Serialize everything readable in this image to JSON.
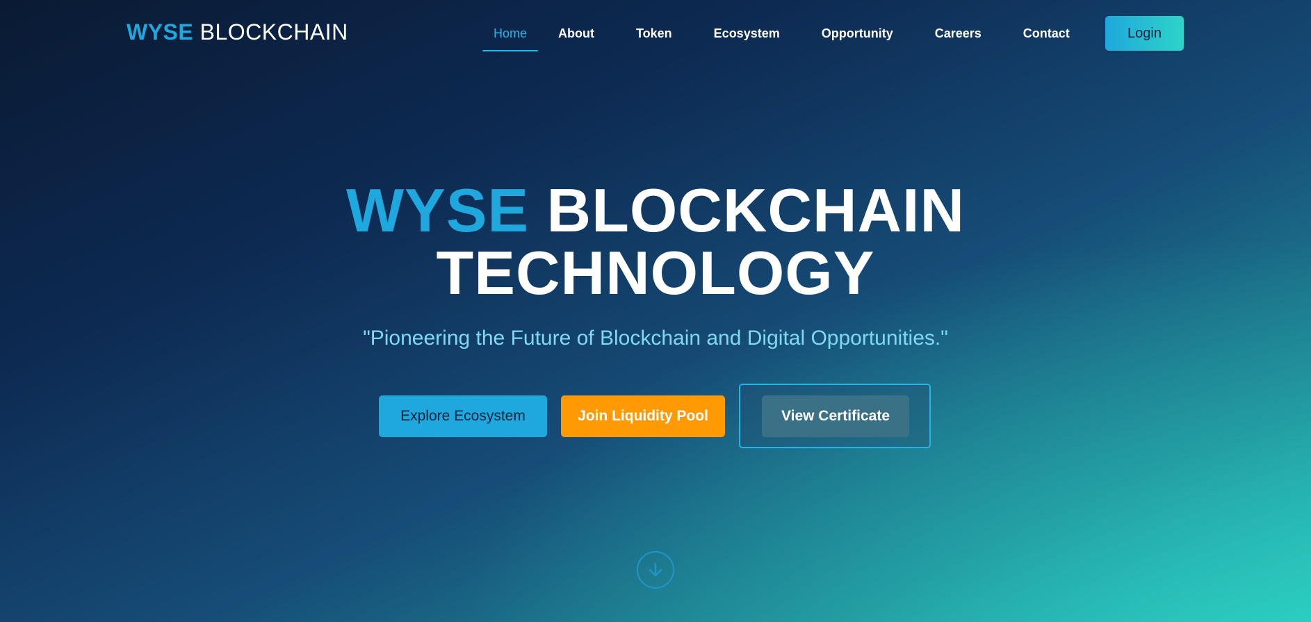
{
  "brand": {
    "accent": "WYSE",
    "rest": "BLOCKCHAIN"
  },
  "nav": {
    "items": [
      {
        "label": "Home",
        "active": true
      },
      {
        "label": "About",
        "active": false
      },
      {
        "label": "Token",
        "active": false
      },
      {
        "label": "Ecosystem",
        "active": false
      },
      {
        "label": "Opportunity",
        "active": false
      },
      {
        "label": "Careers",
        "active": false
      },
      {
        "label": "Contact",
        "active": false
      }
    ],
    "login_label": "Login"
  },
  "hero": {
    "title_accent": "WYSE",
    "title_line1_rest": "BLOCKCHAIN",
    "title_line2": "TECHNOLOGY",
    "tagline": "\"Pioneering the Future of Blockchain and Digital Opportunities.\"",
    "buttons": {
      "explore": "Explore Ecosystem",
      "liquidity": "Join Liquidity Pool",
      "certificate": "View Certificate"
    },
    "scroll_icon": "arrow-down-circle-icon"
  },
  "colors": {
    "accent_blue": "#1fa8dd",
    "accent_orange": "#ff9a05",
    "accent_teal": "#2dd4c8",
    "tagline": "#7fd9f3",
    "bg_dark": "#0a1a33"
  }
}
